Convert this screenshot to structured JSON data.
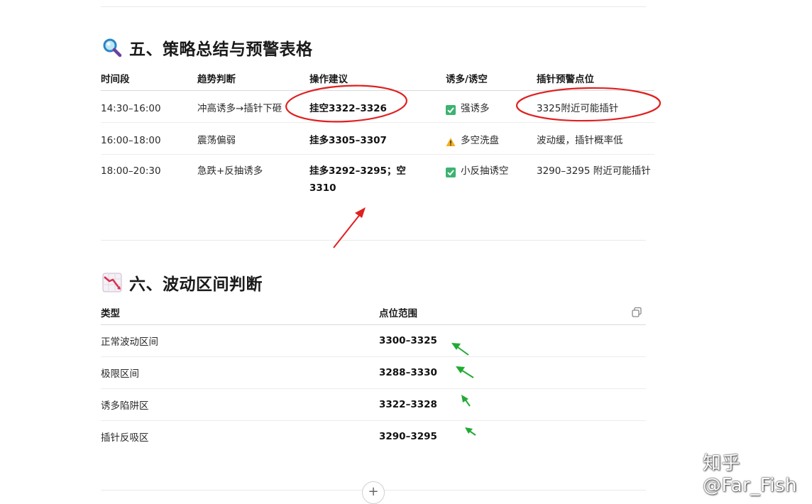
{
  "section5": {
    "title": "五、策略总结与预警表格",
    "icon": "magnifier-icon",
    "headers": [
      "时间段",
      "趋势判断",
      "操作建议",
      "诱多/诱空",
      "插针预警点位"
    ],
    "rows": [
      {
        "time": "14:30–16:00",
        "trend": "冲高诱多→插针下砸",
        "advice": "挂空3322–3326",
        "lure_icon": "check-mark-icon",
        "lure": "强诱多",
        "warn": "3325附近可能插针"
      },
      {
        "time": "16:00–18:00",
        "trend": "震荡偏弱",
        "advice": "挂多3305–3307",
        "lure_icon": "warning-icon",
        "lure": "多空洗盘",
        "warn": "波动缓，插针概率低"
      },
      {
        "time": "18:00–20:30",
        "trend": "急跌+反抽诱多",
        "advice": "挂多3292–3295；空3310",
        "lure_icon": "check-mark-icon",
        "lure": "小反抽诱空",
        "warn": "3290–3295 附近可能插针"
      }
    ]
  },
  "section6": {
    "title": "六、波动区间判断",
    "icon": "chart-decreasing-icon",
    "headers": [
      "类型",
      "点位范围"
    ],
    "copy_icon": "copy-icon",
    "rows": [
      {
        "type": "正常波动区间",
        "range": "3300–3325"
      },
      {
        "type": "极限区间",
        "range": "3288–3330"
      },
      {
        "type": "诱多陷阱区",
        "range": "3322–3328"
      },
      {
        "type": "插针反吸区",
        "range": "3290–3295"
      }
    ]
  },
  "watermark": "知乎 @Far_Fish",
  "colors": {
    "annotation_red": "#e02020",
    "annotation_green": "#22aa33",
    "check_green": "#3cb371"
  }
}
